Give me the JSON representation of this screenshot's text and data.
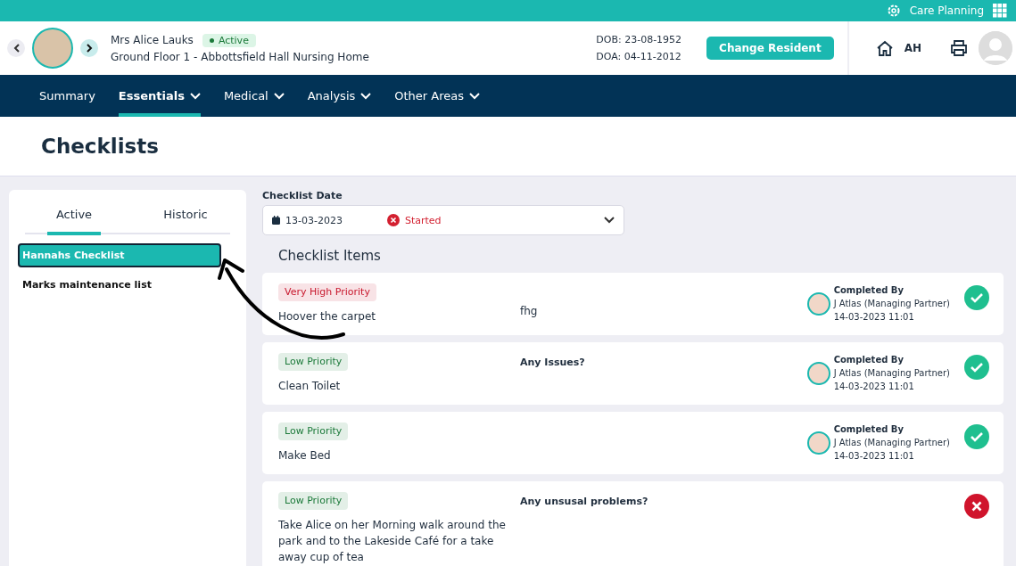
{
  "top_bar": {
    "app_name": "Care Planning"
  },
  "resident": {
    "name": "Mrs Alice Lauks",
    "status": "Active",
    "location": "Ground Floor 1 - Abbottsfield Hall Nursing Home",
    "dob": "DOB: 23-08-1952",
    "doa": "DOA: 04-11-2012"
  },
  "change_button": "Change Resident",
  "user_initials": "AH",
  "nav": [
    {
      "label": "Summary",
      "selected": false,
      "dropdown": false
    },
    {
      "label": "Essentials",
      "selected": true,
      "dropdown": true
    },
    {
      "label": "Medical",
      "selected": false,
      "dropdown": true
    },
    {
      "label": "Analysis",
      "selected": false,
      "dropdown": true
    },
    {
      "label": "Other Areas",
      "selected": false,
      "dropdown": true
    }
  ],
  "page_title": "Checklists",
  "tabs": [
    {
      "label": "Active",
      "selected": true
    },
    {
      "label": "Historic",
      "selected": false
    }
  ],
  "checklists": [
    {
      "label": "Hannahs Checklist",
      "selected": true
    },
    {
      "label": "Marks maintenance list",
      "selected": false
    }
  ],
  "date_field": {
    "label": "Checklist Date",
    "value": "13-03-2023",
    "status": "Started"
  },
  "items_heading": "Checklist Items",
  "items": [
    {
      "color": "#c8192e",
      "priority_label": "Very High Priority",
      "task": "Hoover the carpet",
      "response": "fhg",
      "completed_by": {
        "label": "Completed By",
        "name": "J Atlas (Managing Partner)",
        "time": "14-03-2023 11:01"
      },
      "completed": true
    },
    {
      "color": "#1c7a3a",
      "priority_label": "Low Priority",
      "task": "Clean Toilet",
      "question": "Any Issues?",
      "completed_by": {
        "label": "Completed By",
        "name": "J Atlas (Managing Partner)",
        "time": "14-03-2023 11:01"
      },
      "completed": true
    },
    {
      "color": "#1c7a3a",
      "priority_label": "Low Priority",
      "task": "Make Bed",
      "completed_by": {
        "label": "Completed By",
        "name": "J Atlas (Managing Partner)",
        "time": "14-03-2023 11:01"
      },
      "completed": true
    },
    {
      "color": "#1c7a3a",
      "priority_label": "Low Priority",
      "task": "Take Alice on her Morning walk around the park and to the Lakeside Café for a take away cup of tea",
      "question": "Any unsusal problems?",
      "completed": false
    }
  ]
}
